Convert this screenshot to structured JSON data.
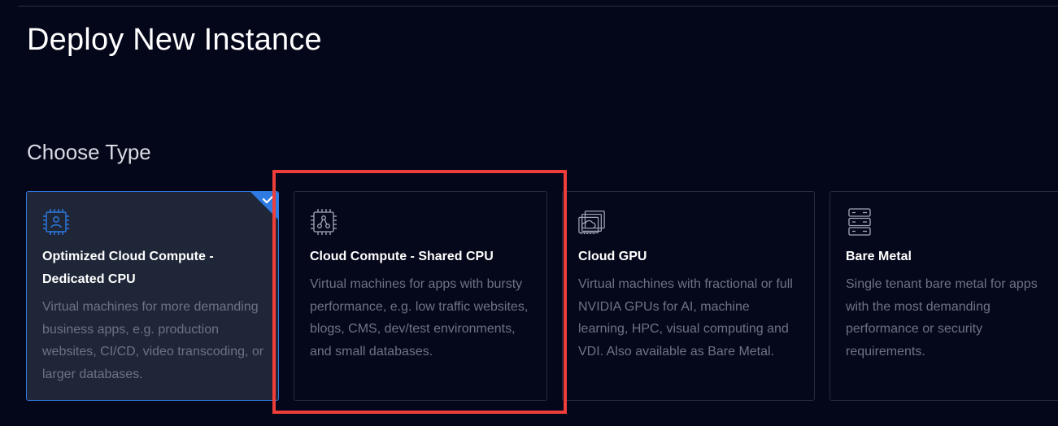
{
  "page": {
    "title": "Deploy New Instance",
    "section_title": "Choose Type"
  },
  "cards": [
    {
      "title": "Optimized Cloud Compute - Dedicated CPU",
      "description": "Virtual machines for more demanding business apps, e.g. production websites, CI/CD, video transcoding, or larger databases.",
      "icon": "cpu-user-icon",
      "selected": true
    },
    {
      "title": "Cloud Compute - Shared CPU",
      "description": "Virtual machines for apps with bursty performance, e.g. low traffic websites, blogs, CMS, dev/test environments, and small databases.",
      "icon": "cpu-share-icon",
      "selected": false
    },
    {
      "title": "Cloud GPU",
      "description": "Virtual machines with fractional or full NVIDIA GPUs for AI, machine learning, HPC, visual computing and VDI. Also available as Bare Metal.",
      "icon": "gpu-cloud-icon",
      "selected": false
    },
    {
      "title": "Bare Metal",
      "description": "Single tenant bare metal for apps with the most demanding performance or security requirements.",
      "icon": "server-rack-icon",
      "selected": false
    }
  ],
  "colors": {
    "background": "#04061a",
    "card_selected": "#1f2638",
    "accent_blue": "#2d7be3",
    "highlight_red": "#ee3e3a",
    "muted_text": "#6d7386"
  }
}
